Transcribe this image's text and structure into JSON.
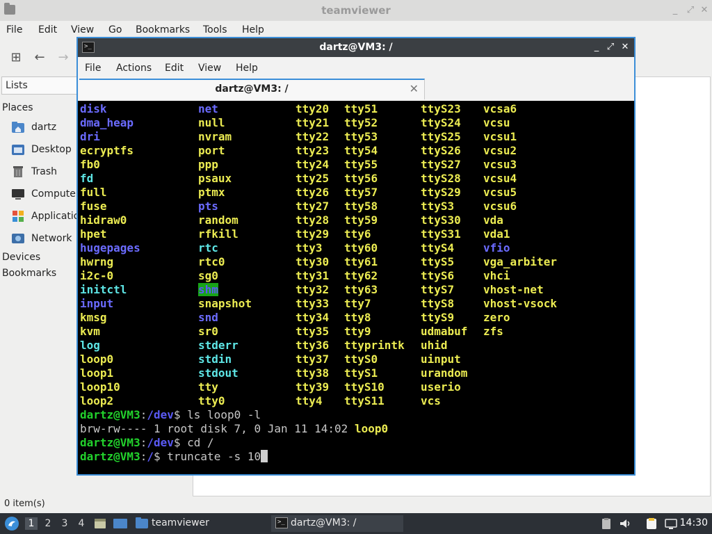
{
  "file_manager": {
    "title": "teamviewer",
    "menu": [
      "File",
      "Edit",
      "View",
      "Go",
      "Bookmarks",
      "Tools",
      "Help"
    ],
    "lists_label": "Lists",
    "places_heading": "Places",
    "places": [
      "dartz",
      "Desktop",
      "Trash",
      "Computer",
      "Applications",
      "Network"
    ],
    "devices_heading": "Devices",
    "bookmarks_heading": "Bookmarks",
    "status": "0 item(s)"
  },
  "terminal": {
    "title": "dartz@VM3: /",
    "menu": [
      "File",
      "Actions",
      "Edit",
      "View",
      "Help"
    ],
    "tab_label": "dartz@VM3: /",
    "listing": [
      [
        [
          "disk",
          "dir"
        ],
        [
          "net",
          "dir"
        ],
        [
          "tty20",
          "dev"
        ],
        [
          "tty51",
          "dev"
        ],
        [
          "ttyS23",
          "dev"
        ],
        [
          "vcsa6",
          "dev"
        ]
      ],
      [
        [
          "dma_heap",
          "dir"
        ],
        [
          "null",
          "dev"
        ],
        [
          "tty21",
          "dev"
        ],
        [
          "tty52",
          "dev"
        ],
        [
          "ttyS24",
          "dev"
        ],
        [
          "vcsu",
          "dev"
        ]
      ],
      [
        [
          "dri",
          "dir"
        ],
        [
          "nvram",
          "dev"
        ],
        [
          "tty22",
          "dev"
        ],
        [
          "tty53",
          "dev"
        ],
        [
          "ttyS25",
          "dev"
        ],
        [
          "vcsu1",
          "dev"
        ]
      ],
      [
        [
          "ecryptfs",
          "dev"
        ],
        [
          "port",
          "dev"
        ],
        [
          "tty23",
          "dev"
        ],
        [
          "tty54",
          "dev"
        ],
        [
          "ttyS26",
          "dev"
        ],
        [
          "vcsu2",
          "dev"
        ]
      ],
      [
        [
          "fb0",
          "dev"
        ],
        [
          "ppp",
          "dev"
        ],
        [
          "tty24",
          "dev"
        ],
        [
          "tty55",
          "dev"
        ],
        [
          "ttyS27",
          "dev"
        ],
        [
          "vcsu3",
          "dev"
        ]
      ],
      [
        [
          "fd",
          "link"
        ],
        [
          "psaux",
          "dev"
        ],
        [
          "tty25",
          "dev"
        ],
        [
          "tty56",
          "dev"
        ],
        [
          "ttyS28",
          "dev"
        ],
        [
          "vcsu4",
          "dev"
        ]
      ],
      [
        [
          "full",
          "dev"
        ],
        [
          "ptmx",
          "dev"
        ],
        [
          "tty26",
          "dev"
        ],
        [
          "tty57",
          "dev"
        ],
        [
          "ttyS29",
          "dev"
        ],
        [
          "vcsu5",
          "dev"
        ]
      ],
      [
        [
          "fuse",
          "dev"
        ],
        [
          "pts",
          "dir"
        ],
        [
          "tty27",
          "dev"
        ],
        [
          "tty58",
          "dev"
        ],
        [
          "ttyS3",
          "dev"
        ],
        [
          "vcsu6",
          "dev"
        ]
      ],
      [
        [
          "hidraw0",
          "dev"
        ],
        [
          "random",
          "dev"
        ],
        [
          "tty28",
          "dev"
        ],
        [
          "tty59",
          "dev"
        ],
        [
          "ttyS30",
          "dev"
        ],
        [
          "vda",
          "dev"
        ]
      ],
      [
        [
          "hpet",
          "dev"
        ],
        [
          "rfkill",
          "dev"
        ],
        [
          "tty29",
          "dev"
        ],
        [
          "tty6",
          "dev"
        ],
        [
          "ttyS31",
          "dev"
        ],
        [
          "vda1",
          "dev"
        ]
      ],
      [
        [
          "hugepages",
          "dir"
        ],
        [
          "rtc",
          "link"
        ],
        [
          "tty3",
          "dev"
        ],
        [
          "tty60",
          "dev"
        ],
        [
          "ttyS4",
          "dev"
        ],
        [
          "vfio",
          "dir"
        ]
      ],
      [
        [
          "hwrng",
          "dev"
        ],
        [
          "rtc0",
          "dev"
        ],
        [
          "tty30",
          "dev"
        ],
        [
          "tty61",
          "dev"
        ],
        [
          "ttyS5",
          "dev"
        ],
        [
          "vga_arbiter",
          "dev"
        ]
      ],
      [
        [
          "i2c-0",
          "dev"
        ],
        [
          "sg0",
          "dev"
        ],
        [
          "tty31",
          "dev"
        ],
        [
          "tty62",
          "dev"
        ],
        [
          "ttyS6",
          "dev"
        ],
        [
          "vhci",
          "dev"
        ]
      ],
      [
        [
          "initctl",
          "link"
        ],
        [
          "shm",
          "hl"
        ],
        [
          "tty32",
          "dev"
        ],
        [
          "tty63",
          "dev"
        ],
        [
          "ttyS7",
          "dev"
        ],
        [
          "vhost-net",
          "dev"
        ]
      ],
      [
        [
          "input",
          "dir"
        ],
        [
          "snapshot",
          "dev"
        ],
        [
          "tty33",
          "dev"
        ],
        [
          "tty7",
          "dev"
        ],
        [
          "ttyS8",
          "dev"
        ],
        [
          "vhost-vsock",
          "dev"
        ]
      ],
      [
        [
          "kmsg",
          "dev"
        ],
        [
          "snd",
          "dir"
        ],
        [
          "tty34",
          "dev"
        ],
        [
          "tty8",
          "dev"
        ],
        [
          "ttyS9",
          "dev"
        ],
        [
          "zero",
          "dev"
        ]
      ],
      [
        [
          "kvm",
          "dev"
        ],
        [
          "sr0",
          "dev"
        ],
        [
          "tty35",
          "dev"
        ],
        [
          "tty9",
          "dev"
        ],
        [
          "udmabuf",
          "dev"
        ],
        [
          "zfs",
          "dev"
        ]
      ],
      [
        [
          "log",
          "link"
        ],
        [
          "stderr",
          "link"
        ],
        [
          "tty36",
          "dev"
        ],
        [
          "ttyprintk",
          "dev"
        ],
        [
          "uhid",
          "dev"
        ]
      ],
      [
        [
          "loop0",
          "dev"
        ],
        [
          "stdin",
          "link"
        ],
        [
          "tty37",
          "dev"
        ],
        [
          "ttyS0",
          "dev"
        ],
        [
          "uinput",
          "dev"
        ]
      ],
      [
        [
          "loop1",
          "dev"
        ],
        [
          "stdout",
          "link"
        ],
        [
          "tty38",
          "dev"
        ],
        [
          "ttyS1",
          "dev"
        ],
        [
          "urandom",
          "dev"
        ]
      ],
      [
        [
          "loop10",
          "dev"
        ],
        [
          "tty",
          "dev"
        ],
        [
          "tty39",
          "dev"
        ],
        [
          "ttyS10",
          "dev"
        ],
        [
          "userio",
          "dev"
        ]
      ],
      [
        [
          "loop2",
          "dev"
        ],
        [
          "tty0",
          "dev"
        ],
        [
          "tty4",
          "dev"
        ],
        [
          "ttyS11",
          "dev"
        ],
        [
          "vcs",
          "dev"
        ]
      ]
    ],
    "prompt_user": "dartz@VM3",
    "cmd1_path": "/dev",
    "cmd1": " ls loop0 -l",
    "ls_output_prefix": "brw-rw---- 1 root disk 7, 0 Jan 11 14:02 ",
    "ls_output_name": "loop0",
    "cmd2_path": "/dev",
    "cmd2": " cd /",
    "cmd3_path": "/",
    "cmd3": " truncate -s 10"
  },
  "taskbar": {
    "workspaces": [
      "1",
      "2",
      "3",
      "4"
    ],
    "task_fm": "teamviewer",
    "task_term": "dartz@VM3: /",
    "clock": "14:30"
  },
  "colors": {
    "dir": "#6b6bff",
    "device": "#ecec52",
    "symlink": "#5ee6e6",
    "prompt_user": "#22d22c",
    "prompt_path": "#5a5af5",
    "active_border": "#3b8ed8"
  }
}
